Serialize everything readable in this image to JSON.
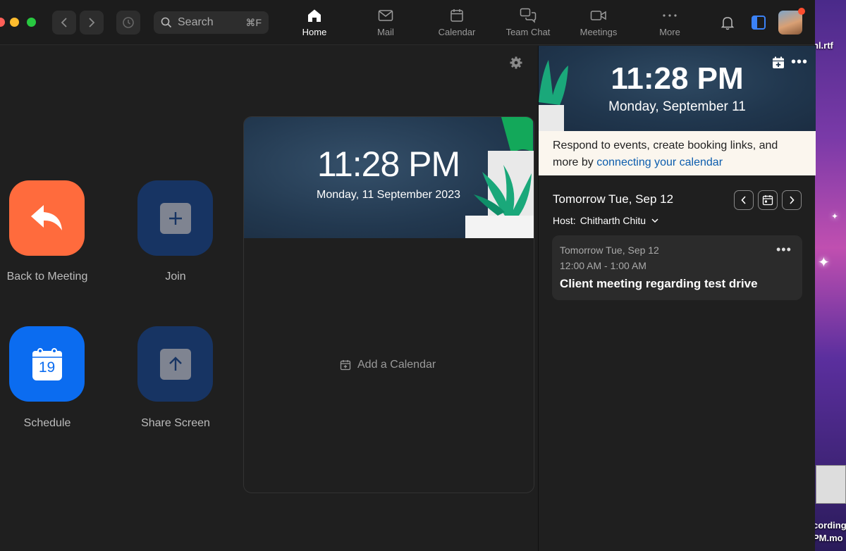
{
  "desktop": {
    "files": [
      "nl.rtf",
      "cording",
      "PM.mo"
    ]
  },
  "nav": {
    "search_label": "Search",
    "search_shortcut": "⌘F",
    "tabs": [
      {
        "label": "Home",
        "icon": "home-icon",
        "active": true
      },
      {
        "label": "Mail",
        "icon": "mail-icon"
      },
      {
        "label": "Calendar",
        "icon": "calendar-icon"
      },
      {
        "label": "Team Chat",
        "icon": "chat-icon"
      },
      {
        "label": "Meetings",
        "icon": "video-icon"
      },
      {
        "label": "More",
        "icon": "more-icon"
      }
    ]
  },
  "actions": {
    "back_to_meeting": "Back to Meeting",
    "join": "Join",
    "schedule": "Schedule",
    "schedule_day": "19",
    "share_screen": "Share Screen"
  },
  "clock_card": {
    "time": "11:28 PM",
    "date": "Monday, 11 September 2023",
    "add_calendar": "Add a Calendar"
  },
  "right_panel": {
    "time": "11:28 PM",
    "date": "Monday, September 11",
    "banner_text": "Respond to events, create booking links, and more by ",
    "banner_link": "connecting your calendar",
    "day_heading": "Tomorrow Tue, Sep 12",
    "host_label": "Host:",
    "host_name": "Chitharth Chitu",
    "event": {
      "date": "Tomorrow Tue, Sep 12",
      "time": "12:00 AM - 1:00 AM",
      "title": "Client meeting regarding test drive"
    }
  },
  "colors": {
    "accent_orange": "#ff6b3d",
    "accent_blue": "#0b6cf0",
    "dark_blue": "#173463",
    "link": "#0b5cad"
  }
}
